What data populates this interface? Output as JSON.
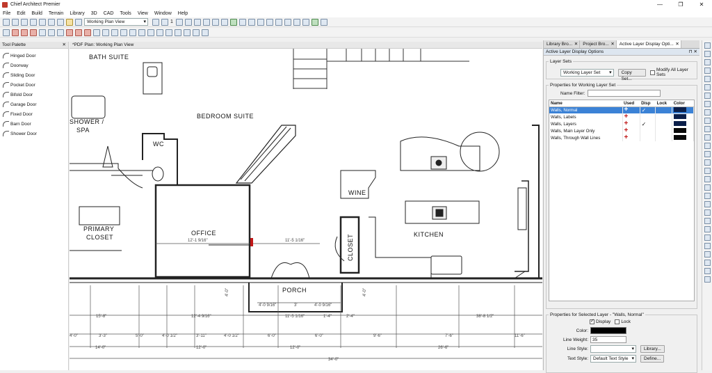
{
  "app": {
    "title": "Chief Architect Premier",
    "window_controls": [
      "—",
      "❐",
      "✕"
    ]
  },
  "menu": [
    "File",
    "Edit",
    "Build",
    "Terrain",
    "Library",
    "3D",
    "CAD",
    "Tools",
    "View",
    "Window",
    "Help"
  ],
  "toolbar": {
    "plan_view": "Working Plan View",
    "layer_count": "1",
    "plan_view_2": "Working Plan View"
  },
  "tool_palette": {
    "title": "Tool Palette",
    "items": [
      "Hinged Door",
      "Doorway",
      "Sliding Door",
      "Pocket Door",
      "Bifold Door",
      "Garage Door",
      "Fixed Door",
      "Barn Door",
      "Shower Door"
    ]
  },
  "drawing": {
    "tab": "*PDF Plan: Working Plan View",
    "rooms": [
      "BATH SUITE",
      "BEDROOM SUITE",
      "SHOWER / SPA",
      "WC",
      "WINE",
      "PRIMARY CLOSET",
      "OFFICE",
      "CLOSET",
      "KITCHEN",
      "PORCH"
    ],
    "dimensions": [
      "12'-1 9/16\"",
      "11'-5 1/16\"",
      "4'-0 9/16\"",
      "3'",
      "4'-0 9/16\"",
      "11'-5 1/16\"",
      "12'-4 9/16\"",
      "15'-8\"",
      "1'-4\"",
      "2'-4\"",
      "38'-8 1/2\"",
      "3'-3\"",
      "5'-0\"",
      "4'-0 1/2\"",
      "3'-11\"",
      "4'-0 1/2\"",
      "6'-0\"",
      "6'-0\"",
      "9'-6\"",
      "7'-6\"",
      "11'-6\"",
      "14'-0\"",
      "12'-0\"",
      "12'-0\"",
      "26'-6\"",
      "34'-0\"",
      "4'-0\"",
      "4'-0\""
    ]
  },
  "right_panel": {
    "tabs": [
      "Library Bro...",
      "Project Bro...",
      "Active Layer Display Opti..."
    ],
    "header": "Active Layer Display Options",
    "layer_sets_label": "Layer Sets",
    "layer_set_value": "Working Layer Set",
    "copy_set_btn": "Copy Set...",
    "modify_all_label": "Modify All Layer Sets",
    "properties_label": "Properties for  Working Layer Set",
    "name_filter_label": "Name Filter:",
    "columns": [
      "Name",
      "Used",
      "Disp",
      "Lock",
      "Color"
    ],
    "layers": [
      {
        "name": "Walls, Normal",
        "used": "+",
        "disp": "✓",
        "selected": true
      },
      {
        "name": "Walls, Labels",
        "used": "+",
        "disp": "",
        "selected": false
      },
      {
        "name": "Walls, Layers",
        "used": "+",
        "disp": "✓",
        "selected": false
      },
      {
        "name": "Walls, Main Layer Only",
        "used": "+",
        "disp": "",
        "selected": false
      },
      {
        "name": "Walls, Through Wall Lines",
        "used": "+",
        "disp": "",
        "selected": false
      }
    ],
    "selected_props_label": "Properties for Selected Layer - \"Walls, Normal\"",
    "display_label": "Display",
    "lock_label": "Lock",
    "color_label": "Color:",
    "line_weight_label": "Line Weight:",
    "line_weight_value": "35",
    "line_style_label": "Line Style:",
    "library_btn": "Library...",
    "text_style_label": "Text Style:",
    "text_style_value": "Default Text Style",
    "define_btn": "Define..."
  }
}
